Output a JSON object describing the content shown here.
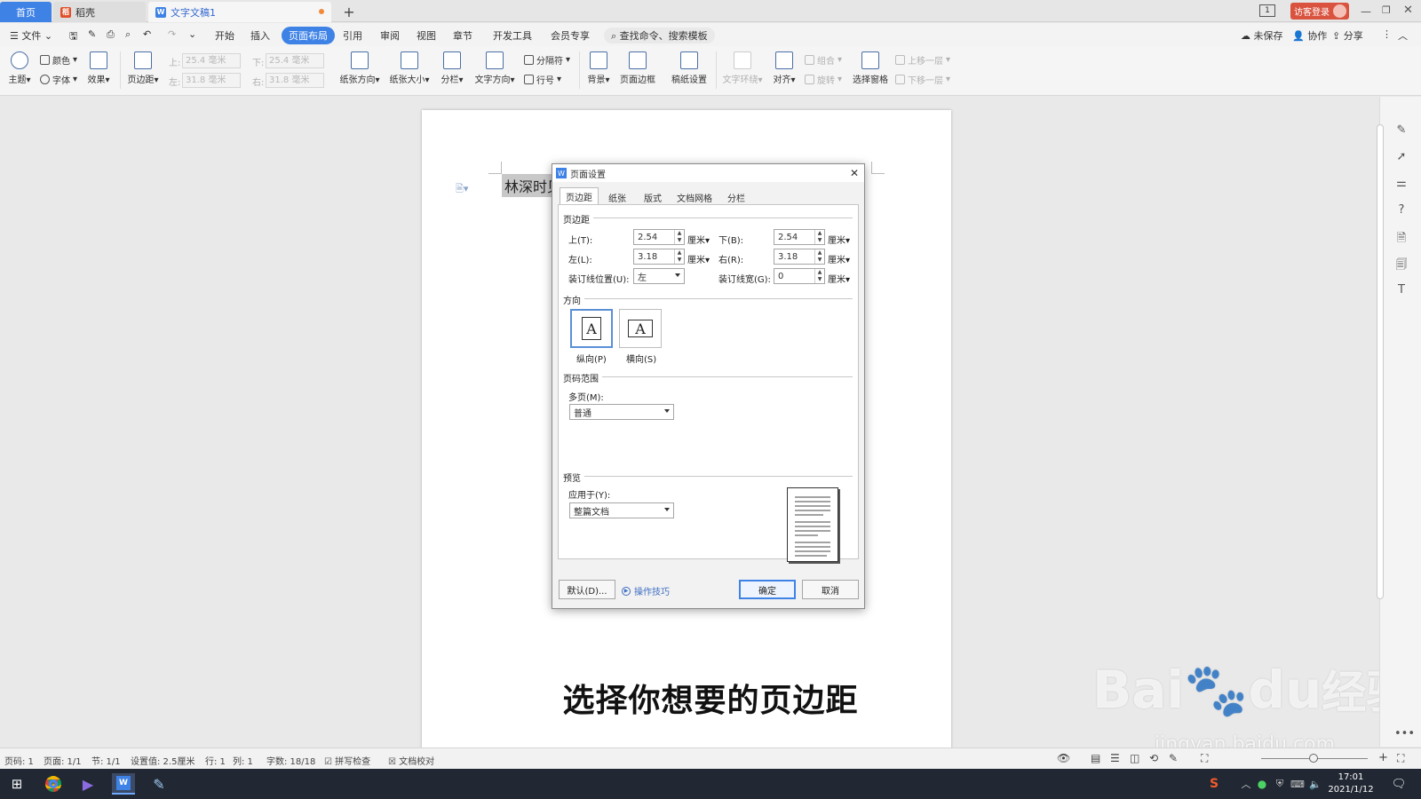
{
  "tabs": {
    "home": "首页",
    "daoke": "稻壳",
    "doc": "文字文稿1",
    "new": "+"
  },
  "titlebar": {
    "visitor": "访客登录",
    "badge": "1"
  },
  "menu": {
    "file": "文件",
    "items": [
      "开始",
      "插入",
      "页面布局",
      "引用",
      "审阅",
      "视图",
      "章节",
      "开发工具",
      "会员专享"
    ],
    "search": "查找命令、搜索模板",
    "unsaved": "未保存",
    "collab": "协作",
    "share": "分享"
  },
  "ribbon": {
    "theme": "主题",
    "color": "颜色",
    "font": "字体",
    "effect": "效果",
    "margins": "页边距",
    "margin_top_lbl": "上:",
    "margin_top_val": "25.4 毫米",
    "margin_bottom_lbl": "下:",
    "margin_bottom_val": "25.4 毫米",
    "margin_left_lbl": "左:",
    "margin_left_val": "31.8 毫米",
    "margin_right_lbl": "右:",
    "margin_right_val": "31.8 毫米",
    "orientation": "纸张方向",
    "size": "纸张大小",
    "columns": "分栏",
    "text_dir": "文字方向",
    "separator": "分隔符",
    "line_num": "行号",
    "background": "背景",
    "page_border": "页面边框",
    "manuscript": "稿纸设置",
    "text_wrap": "文字环绕",
    "align": "对齐",
    "group": "组合",
    "rotate": "旋转",
    "select_pane": "选择窗格",
    "move_up": "上移一层",
    "move_down": "下移一层"
  },
  "document": {
    "text": "林深时见",
    "subtitle": "选择你想要的页边距"
  },
  "dialog": {
    "title": "页面设置",
    "tabs": [
      "页边距",
      "纸张",
      "版式",
      "文档网格",
      "分栏"
    ],
    "section_margins": "页边距",
    "top_label": "上(T):",
    "top_value": "2.54",
    "bottom_label": "下(B):",
    "bottom_value": "2.54",
    "left_label": "左(L):",
    "left_value": "3.18",
    "right_label": "右(R):",
    "right_value": "3.18",
    "gutter_pos_label": "装订线位置(U):",
    "gutter_pos_value": "左",
    "gutter_width_label": "装订线宽(G):",
    "gutter_width_value": "0",
    "unit": "厘米",
    "section_orientation": "方向",
    "portrait": "纵向(P)",
    "landscape": "横向(S)",
    "orientation_glyph": "A",
    "section_pages": "页码范围",
    "multi_label": "多页(M):",
    "multi_value": "普通",
    "section_preview": "预览",
    "apply_label": "应用于(Y):",
    "apply_value": "整篇文档",
    "default_btn": "默认(D)...",
    "tips": "操作技巧",
    "ok": "确定",
    "cancel": "取消"
  },
  "status": {
    "page_code": "页码: 1",
    "pages": "页面: 1/1",
    "section": "节: 1/1",
    "setting": "设置值: 2.5厘米",
    "row": "行: 1",
    "col": "列: 1",
    "words": "字数: 18/18",
    "spell": "拼写检查",
    "proof": "文档校对"
  },
  "taskbar": {
    "time": "17:01",
    "date": "2021/1/12"
  },
  "watermark": {
    "brand": "Bai",
    "brand2": "du",
    "cn": "经验",
    "url": "jingyan.baidu.com"
  }
}
